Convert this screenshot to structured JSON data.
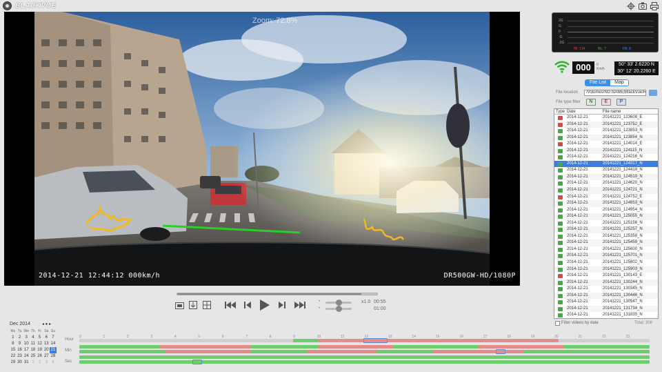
{
  "app": {
    "brand": "BLACKVUE"
  },
  "toolbar": {
    "icons": [
      "crosshair-icon",
      "camera-icon",
      "print-icon"
    ]
  },
  "video": {
    "zoom_text": "Zoom: 72.8%",
    "osd_left": "2014-12-21  12:44:12  000km/h",
    "osd_right": "DR500GW-HD/1080P"
  },
  "playback": {
    "progress": 0.92,
    "speed_label": "x1.0",
    "time_elapsed": "00:55",
    "time_total": "01:00",
    "buttons": [
      "snapshot-icon",
      "export-icon",
      "grid-icon",
      "skip-back-icon",
      "prev-frame-icon",
      "play-icon",
      "next-frame-icon",
      "skip-forward-icon"
    ],
    "speed_level": 0.5,
    "volume_level": 0.5
  },
  "gsensor": {
    "labels": [
      "2G",
      "G",
      "0",
      "-G",
      "-2G"
    ],
    "tb": "TB: 134",
    "rl": "RL: 7",
    "fb": "FB: 8",
    "colors": {
      "tb": "#e04040",
      "rl": "#40c040",
      "fb": "#4080ff"
    }
  },
  "gps": {
    "speed": "000",
    "speed_unit_top": "0",
    "speed_unit_bottom": "Km/h",
    "lat": "50° 33' 2.6220 N",
    "lon": "30° 12' 20.2260 E"
  },
  "tabs": {
    "file_list": "File List",
    "map": "Map"
  },
  "file_panel": {
    "location_label": "File location",
    "location_value": "/Volumes/NO NAME/BlackVue/Re",
    "type_filter_label": "File type filter",
    "filters": [
      "N",
      "E",
      "P"
    ],
    "col_type": "Type",
    "col_date": "Date",
    "col_name": "File name",
    "filter_checkbox_label": "Filter videos by date",
    "total": "Total: 308",
    "files": [
      {
        "date": "2014-12-21",
        "name": "20141221_123608_E",
        "type": "E"
      },
      {
        "date": "2014-12-21",
        "name": "20141221_123752_E",
        "type": "E"
      },
      {
        "date": "2014-12-21",
        "name": "20141221_123853_N",
        "type": "N"
      },
      {
        "date": "2014-12-21",
        "name": "20141221_123854_N",
        "type": "N"
      },
      {
        "date": "2014-12-21",
        "name": "20141221_124014_E",
        "type": "E"
      },
      {
        "date": "2014-12-21",
        "name": "20141221_124115_N",
        "type": "N"
      },
      {
        "date": "2014-12-21",
        "name": "20141221_124216_N",
        "type": "N"
      },
      {
        "date": "2014-12-21",
        "name": "20141221_124317_N",
        "type": "N",
        "selected": true
      },
      {
        "date": "2014-12-21",
        "name": "20141221_124418_N",
        "type": "N"
      },
      {
        "date": "2014-12-21",
        "name": "20141221_124519_N",
        "type": "N"
      },
      {
        "date": "2014-12-21",
        "name": "20141221_124620_N",
        "type": "N"
      },
      {
        "date": "2014-12-21",
        "name": "20141221_124721_N",
        "type": "N"
      },
      {
        "date": "2014-12-21",
        "name": "20141221_124752_E",
        "type": "E"
      },
      {
        "date": "2014-12-21",
        "name": "20141221_124853_N",
        "type": "N"
      },
      {
        "date": "2014-12-21",
        "name": "20141221_124954_N",
        "type": "N"
      },
      {
        "date": "2014-12-21",
        "name": "20141221_125055_N",
        "type": "N"
      },
      {
        "date": "2014-12-21",
        "name": "20141221_125156_N",
        "type": "N"
      },
      {
        "date": "2014-12-21",
        "name": "20141221_125257_N",
        "type": "N"
      },
      {
        "date": "2014-12-21",
        "name": "20141221_125358_N",
        "type": "N"
      },
      {
        "date": "2014-12-21",
        "name": "20141221_125459_N",
        "type": "N"
      },
      {
        "date": "2014-12-21",
        "name": "20141221_125600_N",
        "type": "N"
      },
      {
        "date": "2014-12-21",
        "name": "20141221_125701_N",
        "type": "N"
      },
      {
        "date": "2014-12-21",
        "name": "20141221_125802_N",
        "type": "N"
      },
      {
        "date": "2014-12-21",
        "name": "20141221_125903_N",
        "type": "N"
      },
      {
        "date": "2014-12-21",
        "name": "20141221_130143_E",
        "type": "E"
      },
      {
        "date": "2014-12-21",
        "name": "20141221_130244_N",
        "type": "N"
      },
      {
        "date": "2014-12-21",
        "name": "20141221_130345_N",
        "type": "N"
      },
      {
        "date": "2014-12-21",
        "name": "20141221_130446_N",
        "type": "N"
      },
      {
        "date": "2014-12-21",
        "name": "20141221_130547_N",
        "type": "N"
      },
      {
        "date": "2014-12-21",
        "name": "20141221_131734_N",
        "type": "N"
      },
      {
        "date": "2014-12-21",
        "name": "20141221_131835_N",
        "type": "N"
      }
    ]
  },
  "calendar": {
    "title": "Dec 2014",
    "nav": "◂ ● ▸",
    "weekdays": [
      "Mo",
      "Tu",
      "We",
      "Th",
      "Fr",
      "Sa",
      "Su"
    ],
    "days": [
      "1",
      "2",
      "3",
      "4",
      "5",
      "6",
      "7",
      "8",
      "9",
      "10",
      "11",
      "12",
      "13",
      "14",
      "15",
      "16",
      "17",
      "18",
      "19",
      "20",
      "21",
      "22",
      "23",
      "24",
      "25",
      "26",
      "27",
      "28",
      "29",
      "30",
      "31",
      "1",
      "2",
      "3",
      "4"
    ],
    "selected_day": "21"
  },
  "timeline": {
    "labels": [
      "Hour",
      "Min",
      "Sec"
    ],
    "hour_ticks": [
      "0",
      "1",
      "2",
      "3",
      "4",
      "5",
      "6",
      "7",
      "8",
      "9",
      "10",
      "11",
      "12",
      "13",
      "14",
      "15",
      "16",
      "17",
      "18",
      "19",
      "20",
      "21",
      "22",
      "23"
    ],
    "colors": {
      "normal": "#6ccf6c",
      "event": "#e98a8a",
      "empty": "#d0d0d0",
      "marker": "#5a8fd6"
    }
  }
}
